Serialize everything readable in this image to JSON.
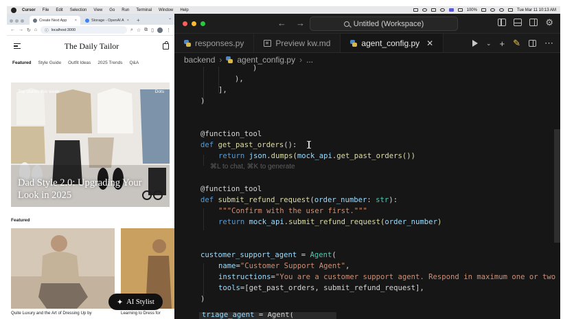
{
  "menubar": {
    "app": "Cursor",
    "items": [
      "File",
      "Edit",
      "Selection",
      "View",
      "Go",
      "Run",
      "Terminal",
      "Window",
      "Help"
    ],
    "battery": "100%",
    "datetime": "Tue Mar 11  10:13 AM"
  },
  "browser": {
    "tabs": [
      {
        "title": "Create Next App"
      },
      {
        "title": "Storage - OpenAI A"
      }
    ],
    "new_tab": "+",
    "url": "localhost:3000"
  },
  "site": {
    "title": "The Daily Tailor",
    "nav": [
      "Featured",
      "Style Guide",
      "Outfit Ideas",
      "2025 Trends",
      "Q&A"
    ],
    "hero": {
      "label": "Top stories this week",
      "dots": "Dots",
      "title": "Dad Style 2.0: Upgrading Your Look in 2025"
    },
    "featured_label": "Featured",
    "cards": [
      {
        "caption": "Quite Luxury and the Art of Dressing Up by"
      },
      {
        "caption": "Learning to Dress for"
      }
    ],
    "stylist_button": "AI Stylist"
  },
  "editor": {
    "workspace": "Untitled (Workspace)",
    "tabs": [
      {
        "label": "responses.py",
        "icon": "python-icon"
      },
      {
        "label": "Preview kw.md",
        "icon": "markdown-preview-icon"
      },
      {
        "label": "agent_config.py",
        "icon": "python-icon",
        "active": true
      }
    ],
    "breadcrumb": [
      "backend",
      "agent_config.py",
      "..."
    ],
    "code": {
      "l1": ")",
      "l2": "),",
      "l3": "],",
      "l4": ")",
      "l5_dec": "@function_tool",
      "l6_def": "def",
      "l6_name": "get_past_orders",
      "l6_rest": "():",
      "l7_ret": "return",
      "l7_a": "json",
      "l7_b": ".dumps(",
      "l7_c": "mock_api",
      "l7_d": ".get_past_orders())",
      "hint": "⌘L to chat, ⌘K to generate",
      "l8_dec": "@function_tool",
      "l9_def": "def",
      "l9_name": "submit_refund_request",
      "l9_a": "(",
      "l9_param": "order_number",
      "l9_b": ": ",
      "l9_type": "str",
      "l9_c": "):",
      "l10_doc": "\"\"\"Confirm with the user first.\"\"\"",
      "l11_ret": "return",
      "l11_a": "mock_api",
      "l11_b": ".submit_refund_request(",
      "l11_c": "order_number",
      "l11_d": ")",
      "l12_var": "customer_support_agent",
      "l12_eq": " = ",
      "l12_cls": "Agent",
      "l12_p": "(",
      "l13_k": "name",
      "l13_eq": "=",
      "l13_v": "\"Customer Support Agent\"",
      "l13_c": ",",
      "l14_k": "instructions",
      "l14_eq": "=",
      "l14_v": "\"You are a customer support agent. Respond in maximum one or two se",
      "l15_k": "tools",
      "l15_eq": "=[",
      "l15_v": "get_past_orders, submit_refund_request",
      "l15_c": "],",
      "l16": ")",
      "sticky_var": "triage_agent",
      "sticky_rest": " = Agent("
    }
  },
  "colors": {
    "editor_bg": "#161616",
    "keyword": "#569cd6",
    "function": "#dcdcaa",
    "string": "#ce9178",
    "variable": "#9cdcfe",
    "type": "#4ec9b0"
  }
}
